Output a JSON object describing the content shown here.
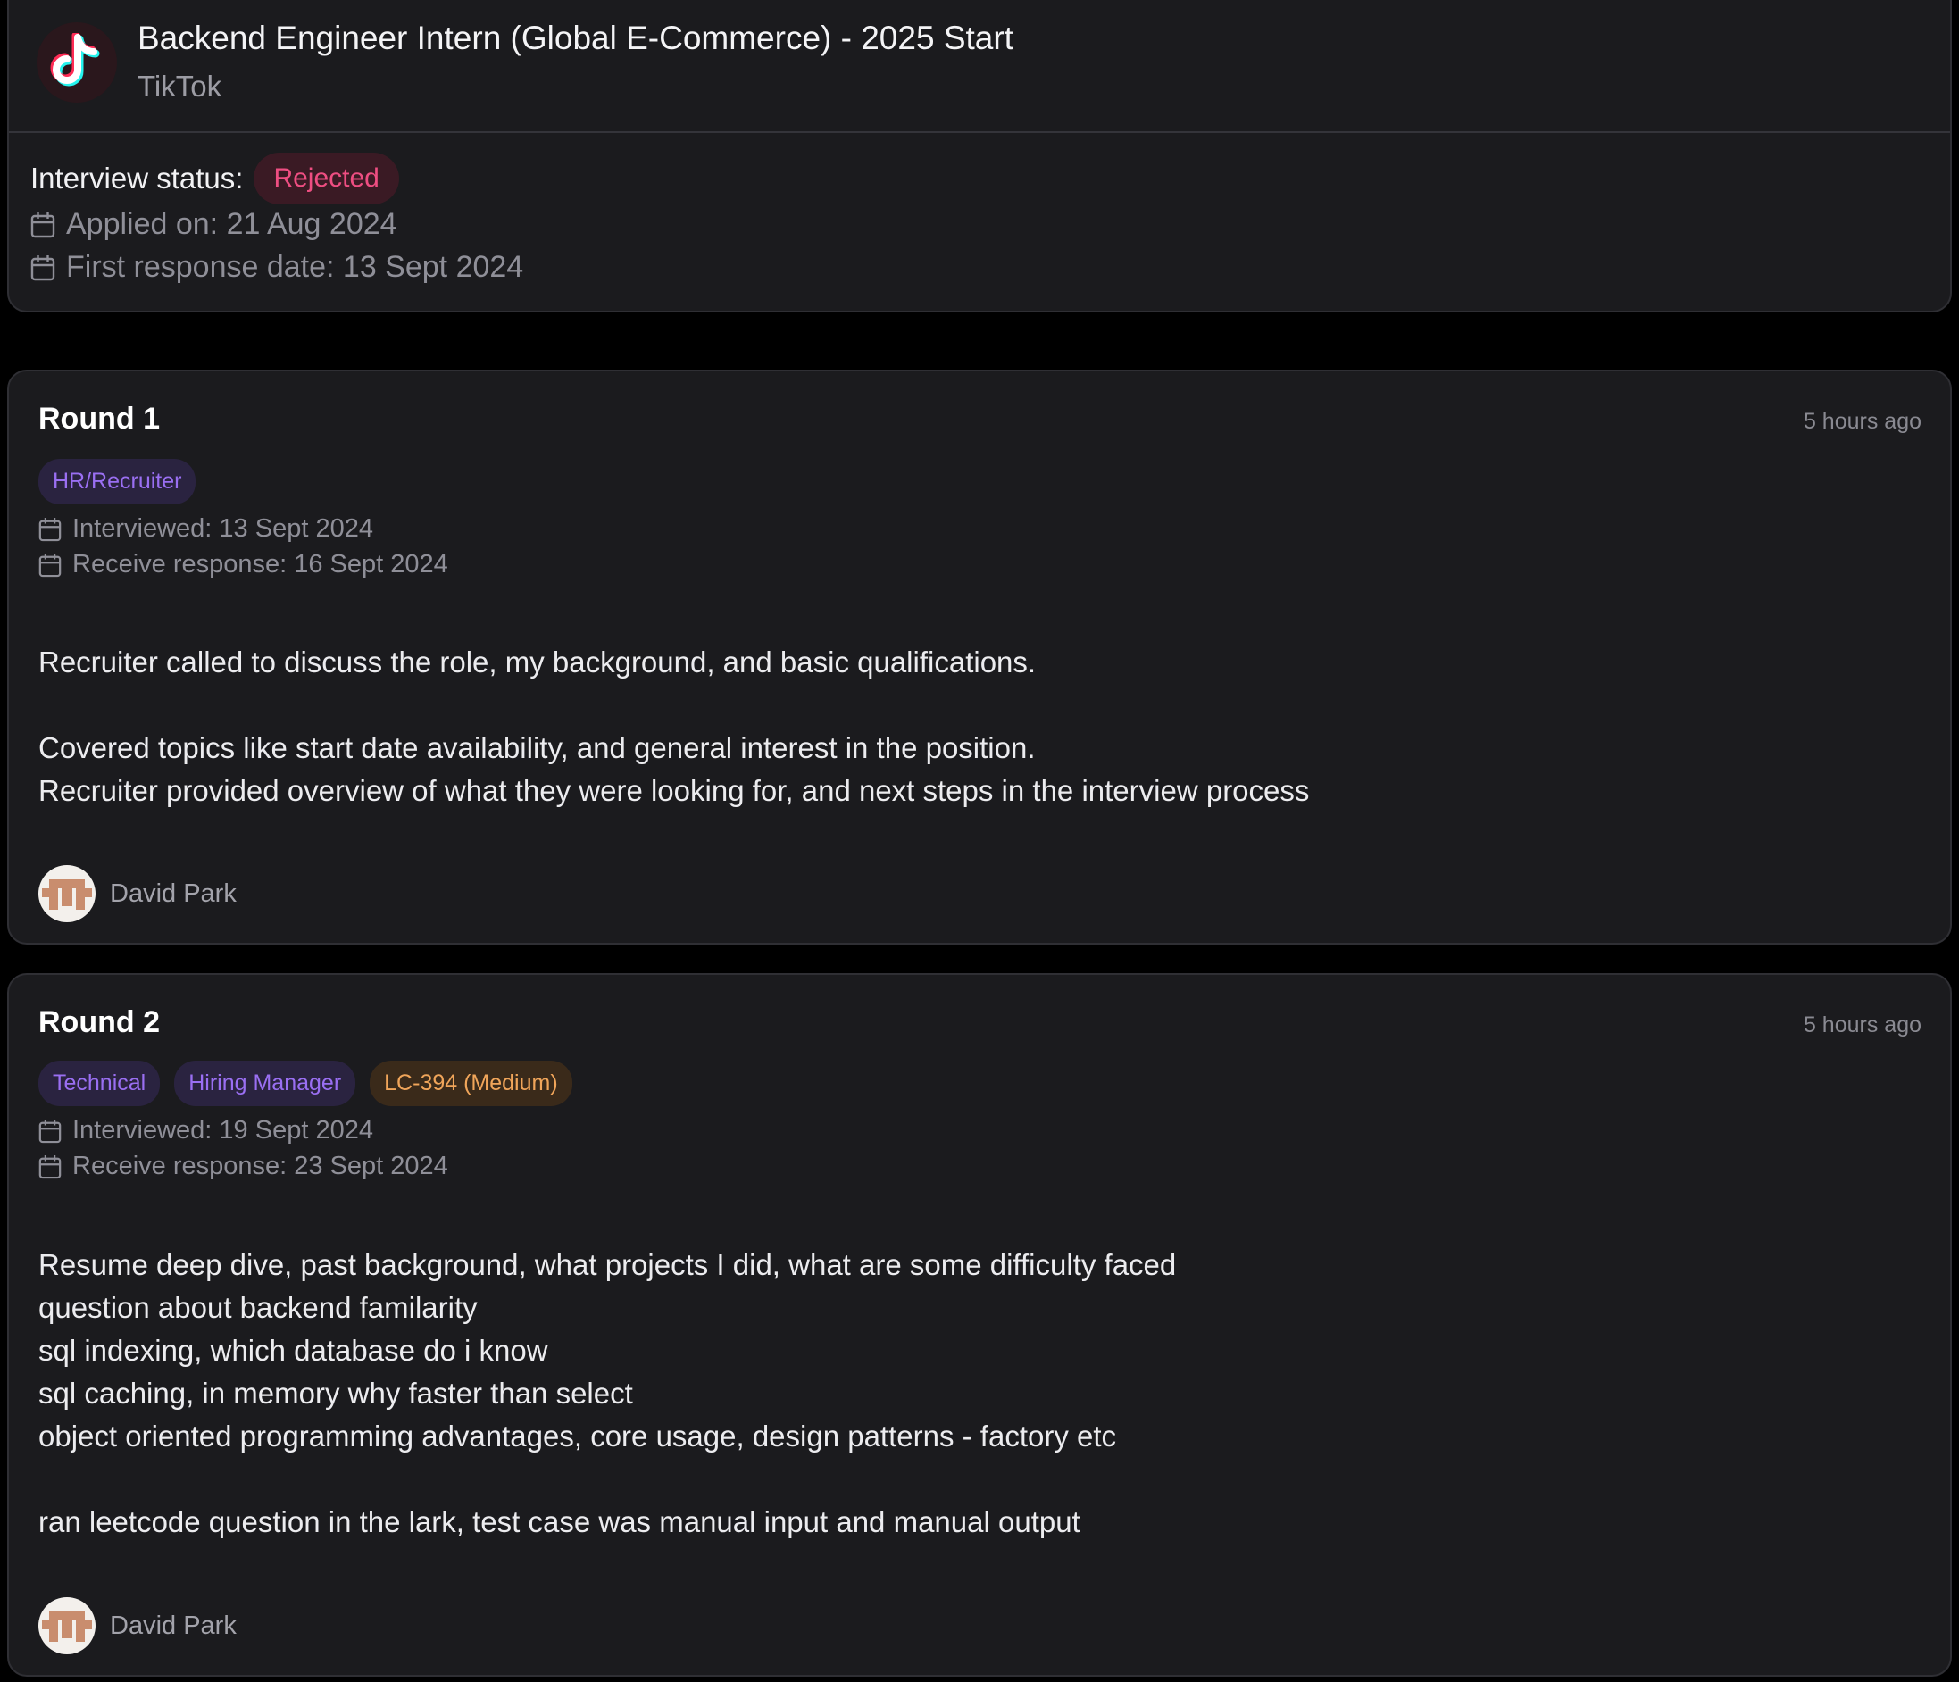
{
  "job": {
    "title": "Backend Engineer Intern (Global E-Commerce) - 2025 Start",
    "company": "TikTok",
    "status_label": "Interview status:",
    "status": "Rejected",
    "applied_on": "Applied on: 21 Aug 2024",
    "first_response": "First response date: 13 Sept 2024"
  },
  "rounds": [
    {
      "title": "Round 1",
      "time_ago": "5 hours ago",
      "tags": [
        "HR/Recruiter"
      ],
      "interviewed": "Interviewed: 13 Sept 2024",
      "response": "Receive response: 16 Sept 2024",
      "notes": "Recruiter called to discuss the role, my background, and basic qualifications.\n\nCovered topics like start date availability, and general interest in the position.\nRecruiter provided overview of what they were looking for, and next steps in the interview process",
      "author": "David Park"
    },
    {
      "title": "Round 2",
      "time_ago": "5 hours ago",
      "tags": [
        "Technical",
        "Hiring Manager",
        "LC-394 (Medium)"
      ],
      "interviewed": "Interviewed: 19 Sept 2024",
      "response": "Receive response: 23 Sept 2024",
      "notes": "Resume deep dive, past background, what projects I did, what are some difficulty faced\nquestion about backend familarity\nsql indexing, which database do i know\nsql caching, in memory why faster than select\nobject oriented programming advantages, core usage, design patterns - factory etc\n\nran leetcode question in the lark, test case was manual input and manual output",
      "author": "David Park"
    }
  ],
  "colors": {
    "background": "#000000",
    "card": "#1b1b1e",
    "rejected": "#ee4e82",
    "tag_purple": "#9a6ff2",
    "tag_orange": "#f0a55a"
  },
  "icons": {
    "logo": "tiktok-logo",
    "date": "calendar-icon",
    "avatar": "user-avatar"
  }
}
